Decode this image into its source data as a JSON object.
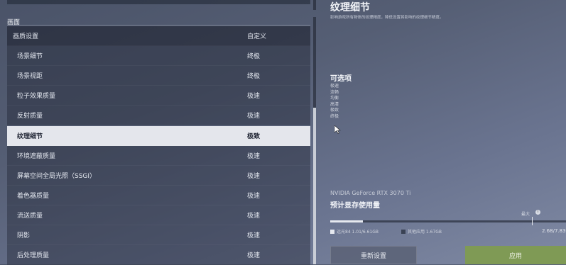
{
  "section": {
    "title": "画面"
  },
  "table": {
    "header": {
      "label": "画质设置",
      "value": "自定义"
    },
    "rows": [
      {
        "label": "场景细节",
        "value": "终极"
      },
      {
        "label": "场景视距",
        "value": "终极"
      },
      {
        "label": "粒子效果质量",
        "value": "极速"
      },
      {
        "label": "反射质量",
        "value": "极速"
      },
      {
        "label": "纹理细节",
        "value": "极致",
        "selected": true
      },
      {
        "label": "环境遮蔽质量",
        "value": "极速"
      },
      {
        "label": "屏幕空间全局光照（SSGI）",
        "value": "极速"
      },
      {
        "label": "着色器质量",
        "value": "极速"
      },
      {
        "label": "流送质量",
        "value": "极速"
      },
      {
        "label": "阴影",
        "value": "极速"
      },
      {
        "label": "后处理质量",
        "value": "极速"
      }
    ]
  },
  "detail": {
    "title": "纹理细节",
    "description": "影响游戏所有物体的纹理精度，降低设置将影响的纹理细节精度。",
    "options_title": "可选项",
    "options": [
      "极速",
      "流畅",
      "均衡",
      "高清",
      "极致",
      "终极"
    ]
  },
  "vram": {
    "gpu": "NVIDIA GeForce RTX 3070 Ti",
    "title": "预计显存使用量",
    "max_label": "最大",
    "fill_fraction": 0.14,
    "max_fraction": 0.855,
    "legend_game": "远光84 1.01/6.61GB",
    "legend_other": "其他应用 1.67GB",
    "total": "2.68/7.83GB",
    "colors": {
      "game": "#e6e9ef",
      "other": "#3a4254"
    }
  },
  "buttons": {
    "reset": "重新设置",
    "apply": "应用"
  }
}
